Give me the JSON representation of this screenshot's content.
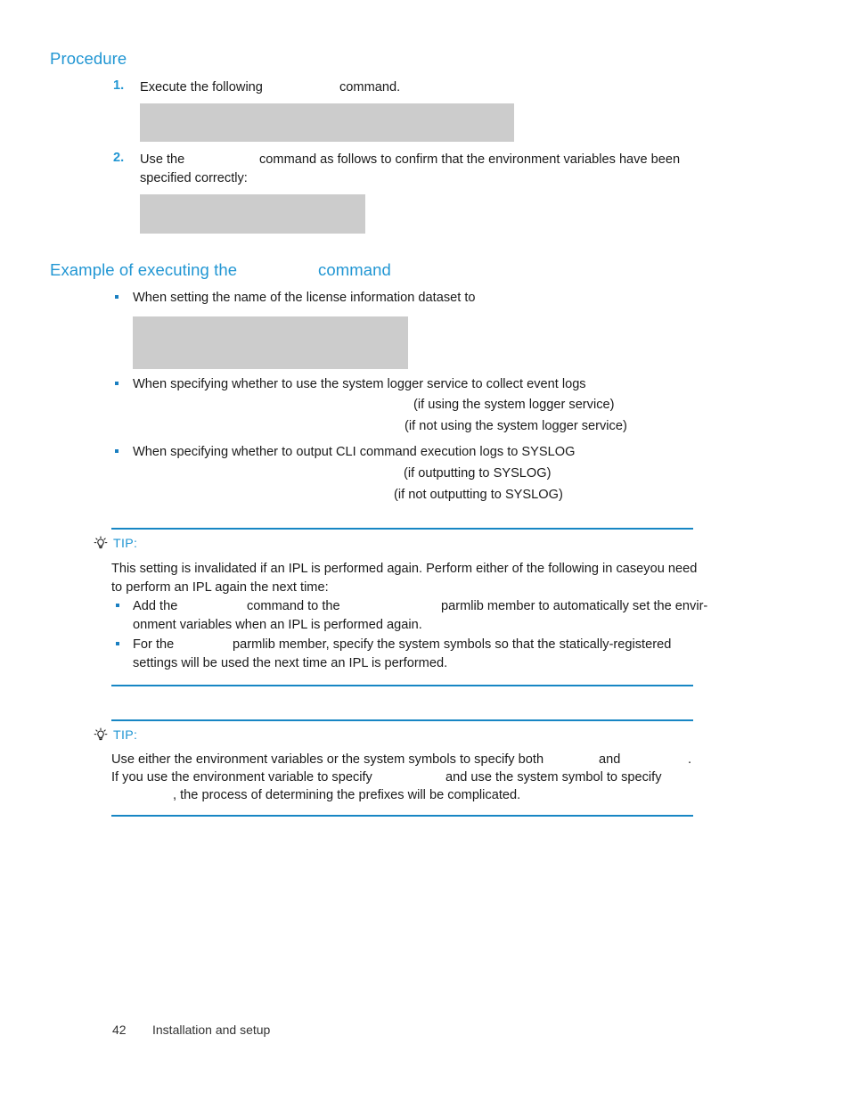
{
  "page": {
    "footer_page_number": "42",
    "footer_title": "Installation and setup",
    "accent_blue": "#2196d3",
    "rule_blue": "#1786c4",
    "redaction_gray": "#cccccc"
  },
  "procedure": {
    "heading": "Procedure",
    "steps": [
      {
        "number": "1.",
        "text_before": "Execute the following",
        "text_after": "command."
      },
      {
        "number": "2.",
        "text_before": "Use the",
        "text_after": "command as follows to confirm that the environment variables have been",
        "text_line2": "specified correctly:"
      }
    ]
  },
  "example_section": {
    "heading_before": "Example of executing the",
    "heading_after": "command",
    "bullets": [
      {
        "text": "When setting the name of the license information dataset to"
      },
      {
        "text": "When specifying whether to use the system logger service to collect event logs",
        "sub_lines": [
          "(if using the system logger service)",
          "(if not using the system logger service)"
        ]
      },
      {
        "text": "When specifying whether to output CLI command execution logs to SYSLOG",
        "sub_lines": [
          "(if outputting to SYSLOG)",
          "(if not outputting to SYSLOG)"
        ]
      }
    ]
  },
  "tip_one": {
    "icon": "lightbulb-icon",
    "label": "TIP:",
    "paragraph_line1": "This setting is invalidated if an IPL is performed again. Perform either of the following in caseyou need",
    "paragraph_line2": "to perform an IPL again the next time:",
    "bullets": [
      {
        "part1": "Add the",
        "part2": "command to the",
        "part3": "parmlib member to automatically set the envir-",
        "line2": "onment variables when an IPL is performed again."
      },
      {
        "part1": "For the",
        "part2": "parmlib member, specify the system symbols so that the statically-registered",
        "line2": "settings will be used the next time an IPL is performed."
      }
    ]
  },
  "tip_two": {
    "icon": "lightbulb-icon",
    "label": "TIP:",
    "line1_part1": "Use either the environment variables or the system symbols to specify both",
    "line1_part2": "and",
    "line1_part3": ".",
    "line2_part1": "If you use the environment variable to specify",
    "line2_part2": "and use the system symbol to specify",
    "line3_part1": ", the process of determining the prefixes will be complicated."
  }
}
